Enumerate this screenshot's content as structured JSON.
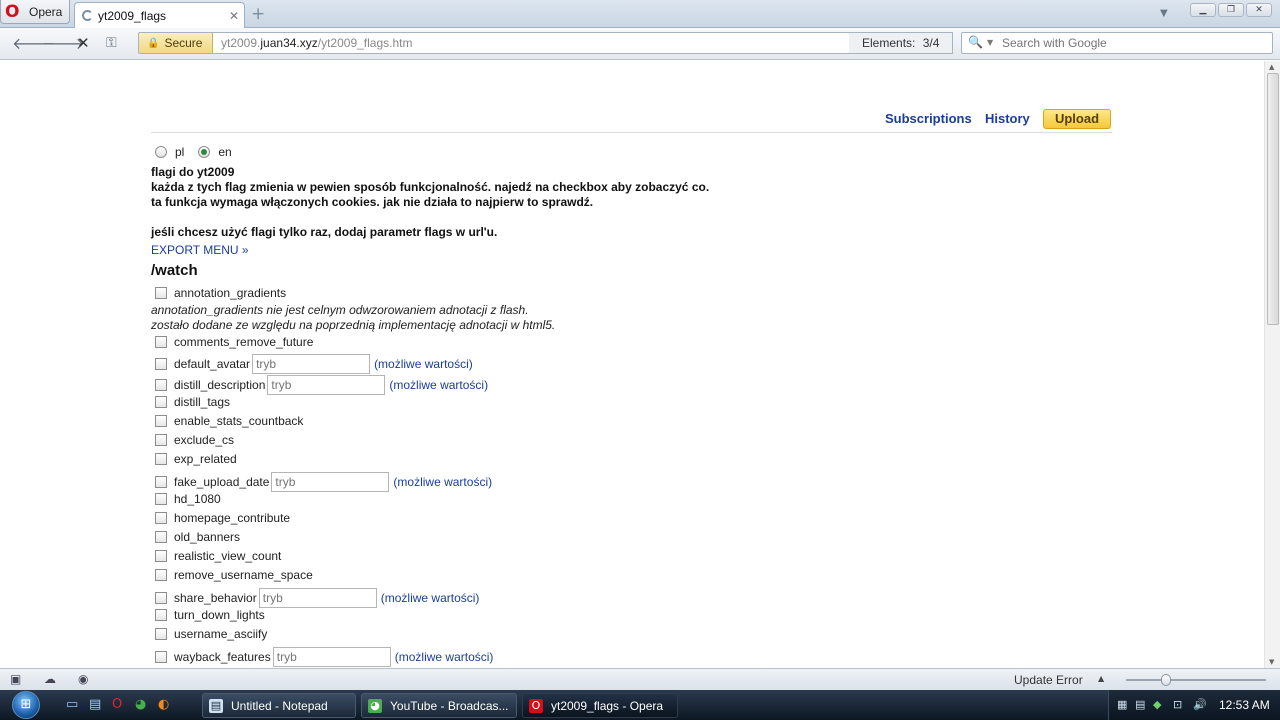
{
  "browser": {
    "menu_label": "Opera",
    "tab_title": "yt2009_flags",
    "tab_close": "✕",
    "new_tab": "+",
    "secure_label": "Secure",
    "url_prefix": "yt2009.",
    "url_domain": "juan34.xyz",
    "url_path": "/yt2009_flags.htm",
    "elements_label": "Elements:",
    "elements_count": "3/4",
    "search_placeholder": "Search with Google"
  },
  "nav": {
    "subscriptions": "Subscriptions",
    "history": "History",
    "upload": "Upload"
  },
  "languages": [
    {
      "label": "pl",
      "selected": false
    },
    {
      "label": "en",
      "selected": true
    }
  ],
  "intro": {
    "line1": "flagi do yt2009",
    "line2": "każda z tych flag zmienia w pewien sposób funkcjonalność. najedź na checkbox aby zobaczyć co.",
    "line3": "ta funkcja wymaga włączonych cookies. jak nie działa to najpierw to sprawdź.",
    "line4": "jeśli chcesz użyć flagi tylko raz, dodaj parametr flags w url'u.",
    "export_link": "EXPORT MENU »",
    "section": "/watch"
  },
  "flag_input_placeholder": "tryb",
  "flag_link_label": "(możliwe wartości)",
  "annotation_desc": {
    "line1": "annotation_gradients nie jest celnym odwzorowaniem adnotacji z flash.",
    "line2": "zostało dodane ze względu na poprzednią implementację adnotacji w html5."
  },
  "flags": [
    {
      "name": "annotation_gradients",
      "has_input": false
    },
    {
      "name": "comments_remove_future",
      "has_input": false
    },
    {
      "name": "default_avatar",
      "has_input": true
    },
    {
      "name": "distill_description",
      "has_input": true
    },
    {
      "name": "distill_tags",
      "has_input": false
    },
    {
      "name": "enable_stats_countback",
      "has_input": false
    },
    {
      "name": "exclude_cs",
      "has_input": false
    },
    {
      "name": "exp_related",
      "has_input": false
    },
    {
      "name": "fake_upload_date",
      "has_input": true
    },
    {
      "name": "hd_1080",
      "has_input": false
    },
    {
      "name": "homepage_contribute",
      "has_input": false
    },
    {
      "name": "old_banners",
      "has_input": false
    },
    {
      "name": "realistic_view_count",
      "has_input": false
    },
    {
      "name": "remove_username_space",
      "has_input": false
    },
    {
      "name": "share_behavior",
      "has_input": true
    },
    {
      "name": "turn_down_lights",
      "has_input": false
    },
    {
      "name": "username_asciify",
      "has_input": false
    },
    {
      "name": "wayback_features",
      "has_input": true
    }
  ],
  "statusbar": {
    "update_status": "Update Error"
  },
  "taskbar": {
    "tasks": [
      {
        "label": "Untitled - Notepad",
        "icon": "notepad-icon",
        "active": false
      },
      {
        "label": "YouTube - Broadcas...",
        "icon": "chrome-icon",
        "active": false
      },
      {
        "label": "yt2009_flags - Opera",
        "icon": "opera-icon",
        "active": true
      }
    ],
    "clock": "12:53 AM"
  },
  "colors": {
    "link": "#1b3e9b",
    "upload_button": "#f4c73a",
    "secure_badge": "#f1d883",
    "radio_selected": "#2d8a3e"
  }
}
